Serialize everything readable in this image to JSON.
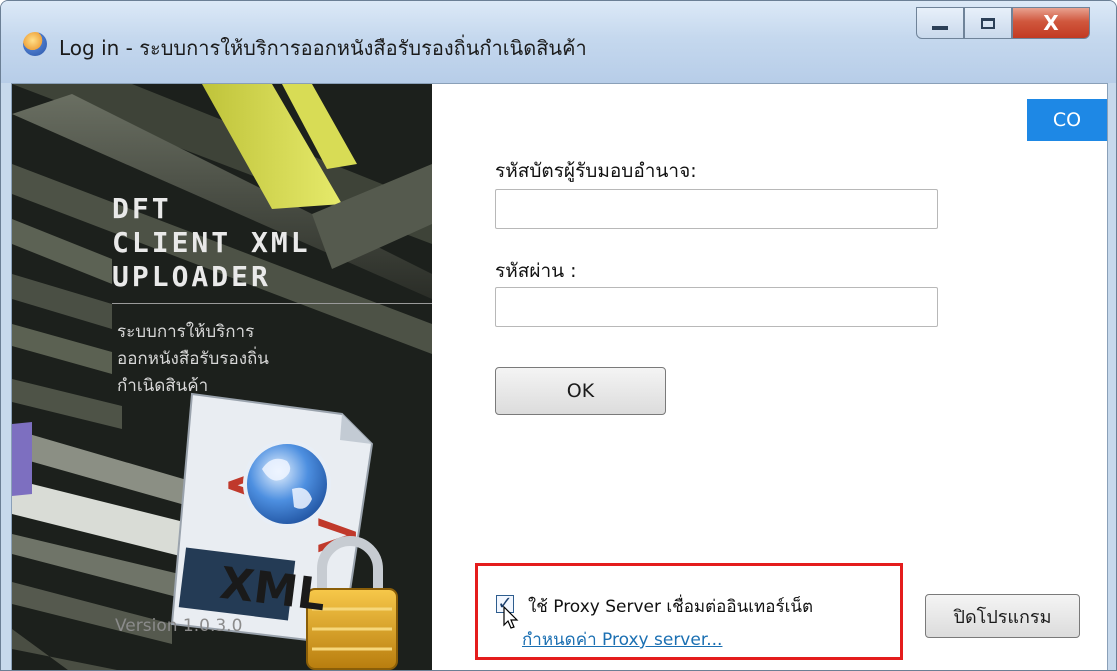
{
  "window": {
    "title": "Log in - ระบบการให้บริการออกหนังสือรับรองถิ่นกำเนิดสินค้า",
    "close_glyph": "X"
  },
  "brand": {
    "line1": "DFT",
    "line2": "CLIENT XML",
    "line3": "UPLOADER",
    "subtitle_line1": "ระบบการให้บริการ",
    "subtitle_line2": "ออกหนังสือรับรองถิ่น",
    "subtitle_line3": "กำเนิดสินค้า",
    "version": "Version 1.0.3.0",
    "xml_badge": "XML"
  },
  "login": {
    "badge": "CO",
    "id_label": "รหัสบัตรผู้รับมอบอำนาจ:",
    "id_value": "",
    "password_label": "รหัสผ่าน :",
    "password_value": "",
    "ok_label": "OK"
  },
  "proxy": {
    "use_proxy_checked": true,
    "check_glyph": "✓",
    "use_proxy_label": "ใช้ Proxy Server  เชื่อมต่ออินเทอร์เน็ต",
    "configure_link": "กำหนดค่า Proxy server..."
  },
  "footer": {
    "exit_label": "ปิดโปรแกรม"
  },
  "colors": {
    "accent": "#1e88e5",
    "highlight": "#e41d1d",
    "link": "#1a6fb2"
  }
}
